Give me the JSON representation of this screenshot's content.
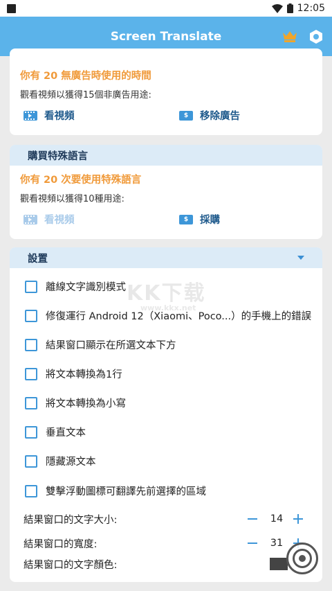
{
  "status_bar": {
    "time": "12:05"
  },
  "app_bar": {
    "title": "Screen Translate",
    "crown_icon": "crown-icon",
    "settings_icon": "hexagon-gear-icon"
  },
  "ad_card": {
    "orange_line": "你有 20 無廣告時使用的時間",
    "note": "觀看視頻以獲得15個非廣告用途:",
    "watch_label": "看視頻",
    "remove_label": "移除廣告"
  },
  "language_card": {
    "header": "購買特殊語言",
    "orange_line": "你有 20 次要使用特殊語言",
    "note": "觀看視頻以獲得10種用途:",
    "watch_label": "看視頻",
    "buy_label": "採購"
  },
  "settings_card": {
    "header": "設置",
    "options": [
      "離線文字識別模式",
      "修復運行 Android 12（Xiaomi、Poco...）的手機上的錯誤",
      "結果窗口顯示在所選文本下方",
      "將文本轉換為1行",
      "將文本轉換為小寫",
      "垂直文本",
      "隱藏源文本",
      "雙擊浮動圖標可翻譯先前選擇的區域"
    ],
    "text_size_label": "結果窗口的文字大小:",
    "text_size_value": "14",
    "width_label": "結果窗口的寬度:",
    "width_value": "31",
    "text_color_label": "結果窗口的文字顏色:"
  },
  "watermark": {
    "text": "KK下载",
    "sub": "www.kkx.net"
  },
  "colors": {
    "accent": "#5bb3ea",
    "orange": "#f09a3a",
    "icon_blue": "#3d96d8"
  }
}
